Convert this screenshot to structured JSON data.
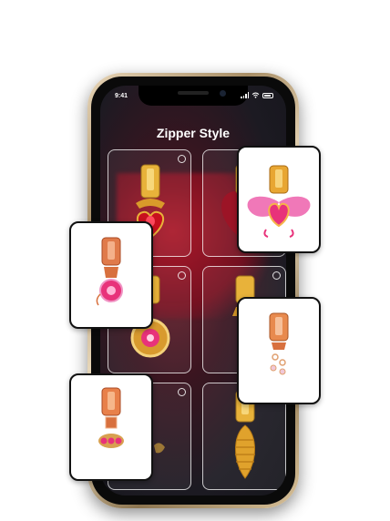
{
  "status_bar": {
    "time": "9:41"
  },
  "screen": {
    "title": "Zipper Style"
  },
  "grid_items": [
    {
      "name": "gold-heart-ruby-zipper",
      "selected": false
    },
    {
      "name": "gold-red-heart-zipper",
      "selected": false
    },
    {
      "name": "gold-flower-medallion-zipper",
      "selected": false
    },
    {
      "name": "gold-pink-gem-zipper",
      "selected": false
    },
    {
      "name": "silver-gem-zipper",
      "selected": false
    },
    {
      "name": "gold-pinecone-zipper",
      "selected": false
    }
  ],
  "floating_cards": [
    {
      "name": "winged-heart-zipper"
    },
    {
      "name": "rose-gold-pink-gem-zipper"
    },
    {
      "name": "rose-gold-chain-zipper"
    },
    {
      "name": "rose-gold-ruby-pendant-zipper"
    }
  ],
  "colors": {
    "accent_gold": "#e8b23a",
    "accent_pink": "#e8327a",
    "rose_gold": "#e07a4a"
  }
}
